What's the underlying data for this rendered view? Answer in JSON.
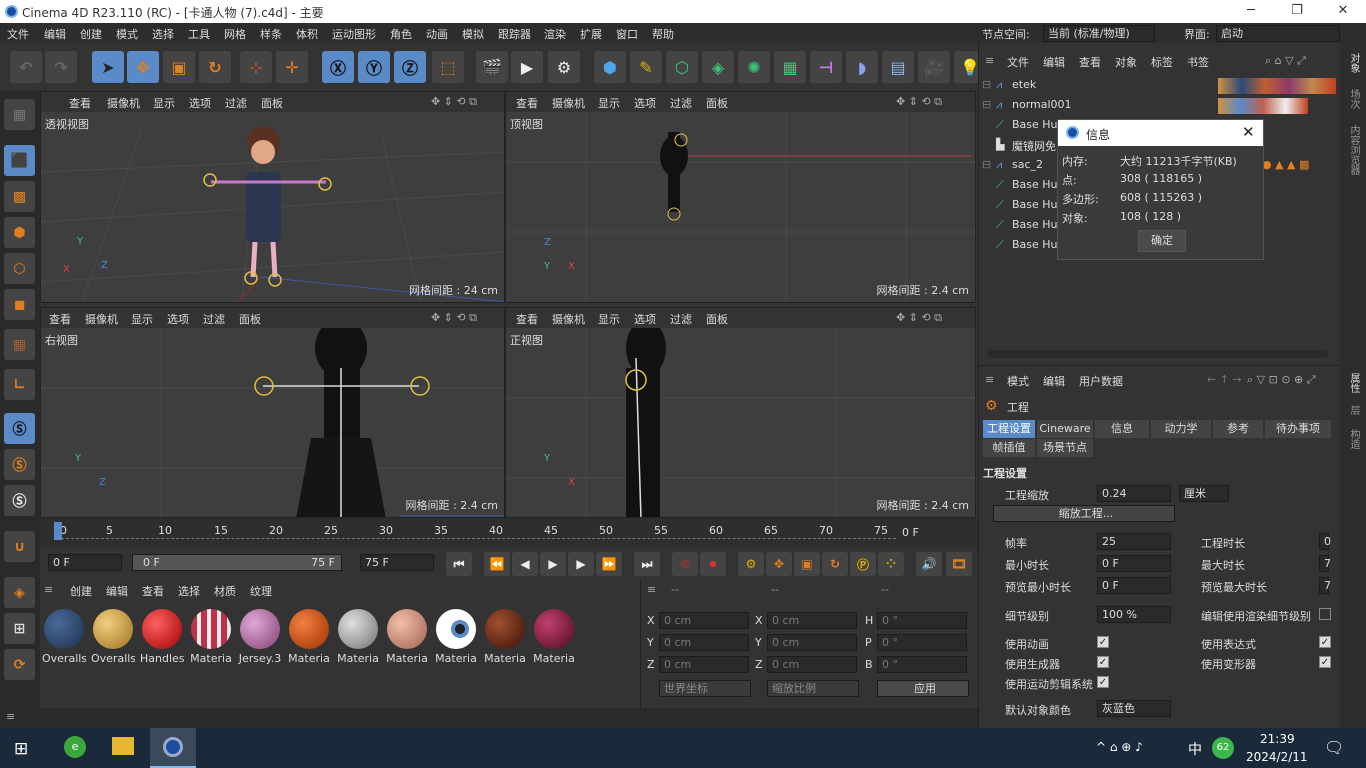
{
  "window": {
    "title": "Cinema 4D R23.110 (RC) - [卡通人物 (7).c4d] - 主要",
    "minimize": "─",
    "maximize": "❐",
    "close": "✕"
  },
  "menu": [
    "文件",
    "编辑",
    "创建",
    "模式",
    "选择",
    "工具",
    "网格",
    "样条",
    "体积",
    "运动图形",
    "角色",
    "动画",
    "模拟",
    "跟踪器",
    "渲染",
    "扩展",
    "窗口",
    "帮助"
  ],
  "node_space": {
    "label": "节点空间:",
    "value": "当前 (标准/物理)"
  },
  "interface": {
    "label": "界面:",
    "value": "启动"
  },
  "viewports": [
    {
      "menus": [
        "查看",
        "摄像机",
        "显示",
        "选项",
        "过滤",
        "面板"
      ],
      "name": "透视视图",
      "grid": "网格间距 : 24 cm"
    },
    {
      "menus": [
        "查看",
        "摄像机",
        "显示",
        "选项",
        "过滤",
        "面板"
      ],
      "name": "顶视图",
      "grid": "网格间距 : 2.4 cm"
    },
    {
      "menus": [
        "查看",
        "摄像机",
        "显示",
        "选项",
        "过滤",
        "面板"
      ],
      "name": "右视图",
      "grid": "网格间距 : 2.4 cm"
    },
    {
      "menus": [
        "查看",
        "摄像机",
        "显示",
        "选项",
        "过滤",
        "面板"
      ],
      "name": "正视图",
      "grid": "网格间距 : 2.4 cm"
    }
  ],
  "axis": {
    "x": "X",
    "y": "Y",
    "z": "Z"
  },
  "objects_panel": {
    "menus": [
      "文件",
      "编辑",
      "查看",
      "对象",
      "标签",
      "书签"
    ],
    "rows": [
      "etek",
      "normal001",
      "Base Hu",
      "魔镜网免",
      "sac_2",
      "Base Hu",
      "Base Hu",
      "Base Hu",
      "Base Hu"
    ]
  },
  "info_dialog": {
    "title": "信息",
    "rows": [
      [
        "内存:",
        "大约 11213千字节(KB)"
      ],
      [
        "点:",
        "308 ( 118165 )"
      ],
      [
        "多边形:",
        "608 ( 115263 )"
      ],
      [
        "对象:",
        "108 ( 128 )"
      ]
    ],
    "ok": "确定"
  },
  "attr_panel": {
    "menus": [
      "模式",
      "编辑",
      "用户数据"
    ],
    "title": "工程",
    "tabs": [
      "工程设置",
      "Cineware",
      "信息",
      "动力学",
      "参考",
      "待办事项"
    ],
    "tabs2": [
      "帧插值",
      "场景节点"
    ],
    "section": "工程设置",
    "scale_label": "工程缩放",
    "scale_value": "0.24",
    "scale_unit": "厘米",
    "scale_button": "缩放工程...",
    "fps_label": "帧率",
    "fps_value": "25",
    "duration_label": "工程时长",
    "duration_value": "0",
    "min_label": "最小时长",
    "min_value": "0 F",
    "max_label": "最大时长",
    "max_value": "7",
    "pmin_label": "预览最小时长",
    "pmin_value": "0 F",
    "pmax_label": "预览最大时长",
    "pmax_value": "7",
    "lod_label": "细节级别",
    "lod_value": "100 %",
    "render_lod_label": "编辑使用渲染细节级别",
    "anim_label": "使用动画",
    "expr_label": "使用表达式",
    "gen_label": "使用生成器",
    "deform_label": "使用变形器",
    "motion_label": "使用运动剪辑系统",
    "default_label": "默认对象颜色",
    "default_value": "灰蓝色"
  },
  "timeline": {
    "ticks": [
      "0",
      "5",
      "10",
      "15",
      "20",
      "25",
      "30",
      "35",
      "40",
      "45",
      "50",
      "55",
      "60",
      "65",
      "70",
      "75"
    ],
    "current": "0 F",
    "start": "0 F",
    "range_start": "0 F",
    "range_end": "75 F",
    "end": "75 F"
  },
  "materials_panel": {
    "menus": [
      "创建",
      "编辑",
      "查看",
      "选择",
      "材质",
      "纹理"
    ],
    "items": [
      {
        "name": "Overalls",
        "color": "#1d2f4a"
      },
      {
        "name": "Overalls",
        "color": "#c9a24a"
      },
      {
        "name": "Handles",
        "color": "#e01010"
      },
      {
        "name": "Materia",
        "color": "#c0304a"
      },
      {
        "name": "Jersey.3",
        "color": "#a86a9a"
      },
      {
        "name": "Materia",
        "color": "#d05a20"
      },
      {
        "name": "Materia",
        "color": "#aaaaaa"
      },
      {
        "name": "Materia",
        "color": "#c88a70"
      },
      {
        "name": "Materia",
        "color": "#eeeeee"
      },
      {
        "name": "Materia",
        "color": "#5a2a1a"
      },
      {
        "name": "Materia",
        "color": "#7a1a3a"
      }
    ]
  },
  "coords_panel": {
    "dashes": [
      "--",
      "--",
      "--"
    ],
    "rows": [
      [
        "X",
        "0 cm",
        "X",
        "0 cm",
        "H",
        "0 °"
      ],
      [
        "Y",
        "0 cm",
        "Y",
        "0 cm",
        "P",
        "0 °"
      ],
      [
        "Z",
        "0 cm",
        "Z",
        "0 cm",
        "B",
        "0 °"
      ]
    ],
    "world": "世界坐标",
    "scale": "缩放比例",
    "apply": "应用"
  },
  "right_tabs": [
    "对象",
    "场次",
    "内容浏览器",
    "属性",
    "层",
    "构造"
  ],
  "taskbar": {
    "time": "21:39",
    "date": "2024/2/11",
    "ime": "中",
    "badge": "62"
  },
  "colors": {
    "accent": "#5a8ac8",
    "active_tab": "#4a7ab8",
    "yellow": "#e0b000",
    "orange": "#e08020"
  }
}
